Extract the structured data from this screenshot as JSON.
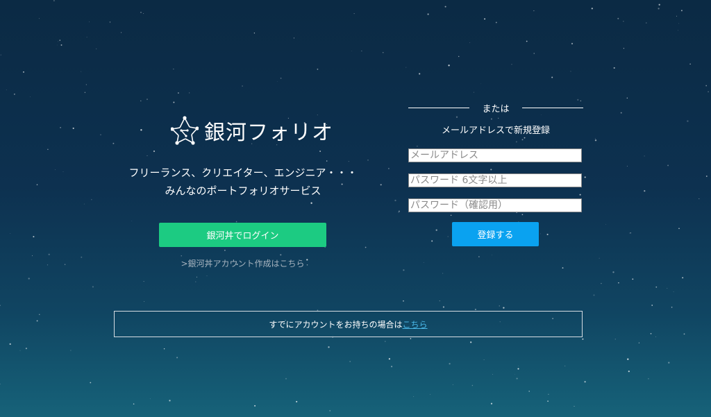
{
  "brand": {
    "name": "銀河フォリオ",
    "logo_icon": "constellation-star-icon"
  },
  "tagline": {
    "line1": "フリーランス、クリエイター、エンジニア・・・",
    "line2": "みんなのポートフォリオサービス"
  },
  "login": {
    "button_label": "銀河丼でログイン",
    "create_account_link": ">銀河丼アカウント作成はこちら"
  },
  "register": {
    "divider_text": "または",
    "title": "メールアドレスで新規登録",
    "email_placeholder": "メールアドレス",
    "password_placeholder": "パスワード 6文字以上",
    "password_confirm_placeholder": "パスワード（確認用）",
    "submit_label": "登録する"
  },
  "existing_account": {
    "text": "すでにアカウントをお持ちの場合は",
    "link_label": "こちら"
  },
  "colors": {
    "login_button": "#1ccb82",
    "register_button": "#0aa2f0",
    "link": "#49b6e6"
  }
}
